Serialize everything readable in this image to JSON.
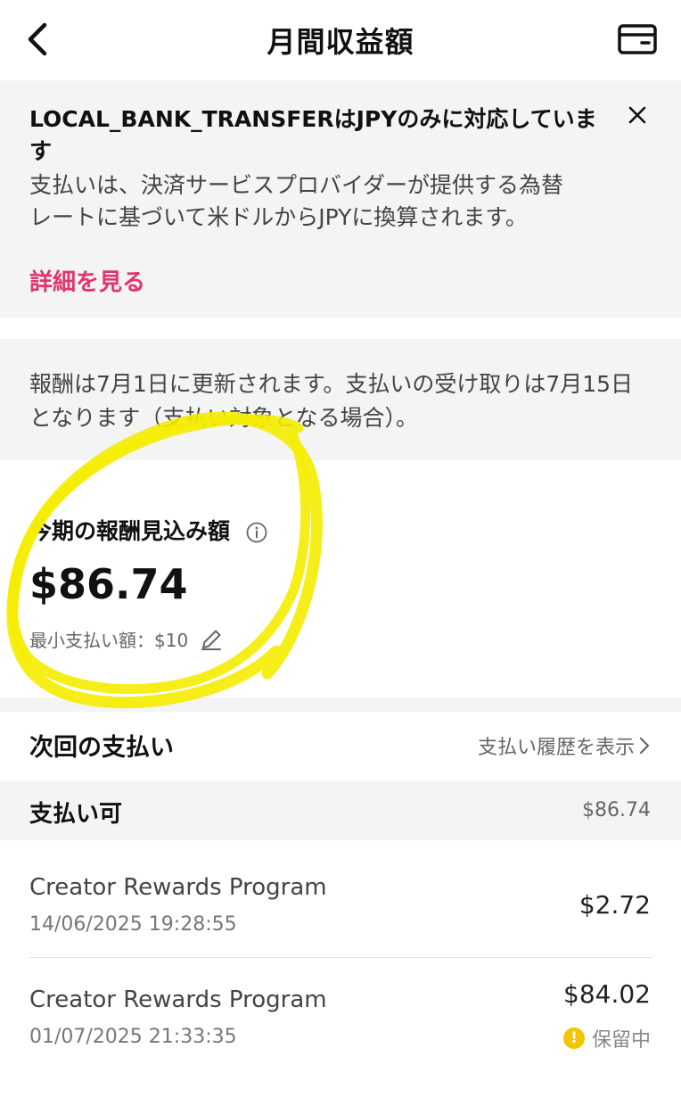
{
  "header": {
    "title": "月間収益額",
    "back_icon": "chevron-left-icon",
    "wallet_icon": "wallet-icon"
  },
  "notice": {
    "title": "LOCAL_BANK_TRANSFERはJPYのみに対応しています",
    "body": "支払いは、決済サービスプロバイダーが提供する為替レートに基づいて米ドルからJPYに換算されます。",
    "link": "詳細を見る",
    "link_color": "#e0366a"
  },
  "info": {
    "text": "報酬は7月1日に更新されます。支払いの受け取りは7月15日となります（支払い対象となる場合）。"
  },
  "estimate": {
    "label": "今期の報酬見込み額",
    "amount": "$86.74",
    "min_payout": "最小支払い額：$10"
  },
  "next_payment": {
    "title": "次回の支払い",
    "history_link": "支払い履歴を表示"
  },
  "payable": {
    "label": "支払い可",
    "amount": "$86.74"
  },
  "transactions": [
    {
      "name": "Creator Rewards Program",
      "date": "14/06/2025 19:28:55",
      "amount": "$2.72"
    },
    {
      "name": "Creator Rewards Program",
      "date": "01/07/2025 21:33:35",
      "amount": "$84.02",
      "status": "保留中",
      "status_icon_color": "#f3c500"
    }
  ],
  "annotation": {
    "highlight_color": "#f5ec00"
  }
}
